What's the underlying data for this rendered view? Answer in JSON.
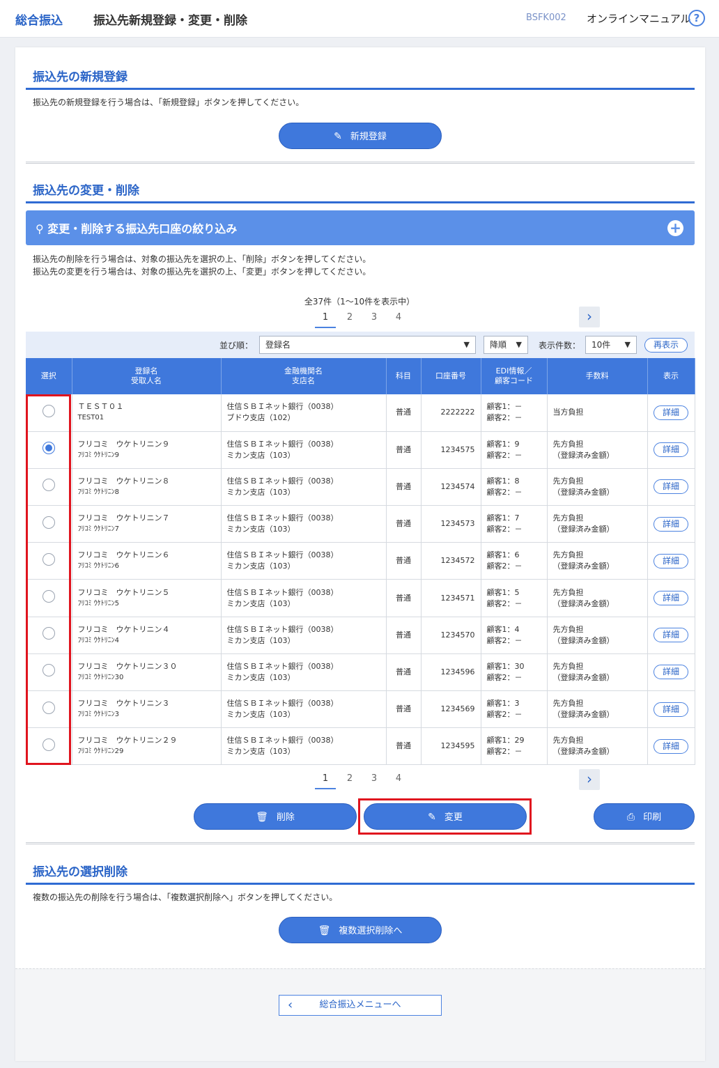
{
  "header": {
    "brand": "総合振込",
    "title": "振込先新規登録・変更・削除",
    "screen_code": "BSFK002",
    "manual_label": "オンラインマニュアル",
    "help_icon": "?"
  },
  "new_section": {
    "title": "振込先の新規登録",
    "note": "振込先の新規登録を行う場合は、「新規登録」ボタンを押してください。",
    "button_label": "新規登録"
  },
  "edit_section": {
    "title": "振込先の変更・削除",
    "filter_title": "変更・削除する振込先口座の絞り込み",
    "note_line1": "振込先の削除を行う場合は、対象の振込先を選択の上、「削除」ボタンを押してください。",
    "note_line2": "振込先の変更を行う場合は、対象の振込先を選択の上、「変更」ボタンを押してください。",
    "count_text": "全37件（1～10件を表示中）",
    "pages": [
      "1",
      "2",
      "3",
      "4"
    ],
    "next_symbol": "›",
    "sort_label": "並び順：",
    "sort_value": "登録名",
    "order_value": "降順",
    "per_page_label": "表示件数：",
    "per_page_value": "10件",
    "redisplay_label": "再表示",
    "columns": [
      "選択",
      "登録名",
      "受取人名",
      "金融機関名",
      "支店名",
      "科目",
      "口座番号",
      "EDI情報／",
      "顧客コード",
      "手数料",
      "表示"
    ],
    "rows": [
      {
        "name": "ＴＥＳＴ０１",
        "kana": "TEST01",
        "bank": "住信ＳＢＩネット銀行（0038）",
        "branch": "ブドウ支店（102）",
        "type": "普通",
        "account": "2222222",
        "edi1": "顧客1：－",
        "edi2": "顧客2：－",
        "fee1": "当方負担",
        "fee2": "",
        "detail": "詳細",
        "selected": false
      },
      {
        "name": "フリコミ　ウケトリニン９",
        "kana": "ﾌﾘｺﾐ ｳｹﾄﾘﾆﾝ9",
        "bank": "住信ＳＢＩネット銀行（0038）",
        "branch": "ミカン支店（103）",
        "type": "普通",
        "account": "1234575",
        "edi1": "顧客1：9",
        "edi2": "顧客2：－",
        "fee1": "先方負担",
        "fee2": "（登録済み金額）",
        "detail": "詳細",
        "selected": true
      },
      {
        "name": "フリコミ　ウケトリニン８",
        "kana": "ﾌﾘｺﾐ ｳｹﾄﾘﾆﾝ8",
        "bank": "住信ＳＢＩネット銀行（0038）",
        "branch": "ミカン支店（103）",
        "type": "普通",
        "account": "1234574",
        "edi1": "顧客1：8",
        "edi2": "顧客2：－",
        "fee1": "先方負担",
        "fee2": "（登録済み金額）",
        "detail": "詳細",
        "selected": false
      },
      {
        "name": "フリコミ　ウケトリニン７",
        "kana": "ﾌﾘｺﾐ ｳｹﾄﾘﾆﾝ7",
        "bank": "住信ＳＢＩネット銀行（0038）",
        "branch": "ミカン支店（103）",
        "type": "普通",
        "account": "1234573",
        "edi1": "顧客1：7",
        "edi2": "顧客2：－",
        "fee1": "先方負担",
        "fee2": "（登録済み金額）",
        "detail": "詳細",
        "selected": false
      },
      {
        "name": "フリコミ　ウケトリニン６",
        "kana": "ﾌﾘｺﾐ ｳｹﾄﾘﾆﾝ6",
        "bank": "住信ＳＢＩネット銀行（0038）",
        "branch": "ミカン支店（103）",
        "type": "普通",
        "account": "1234572",
        "edi1": "顧客1：6",
        "edi2": "顧客2：－",
        "fee1": "先方負担",
        "fee2": "（登録済み金額）",
        "detail": "詳細",
        "selected": false
      },
      {
        "name": "フリコミ　ウケトリニン５",
        "kana": "ﾌﾘｺﾐ ｳｹﾄﾘﾆﾝ5",
        "bank": "住信ＳＢＩネット銀行（0038）",
        "branch": "ミカン支店（103）",
        "type": "普通",
        "account": "1234571",
        "edi1": "顧客1：5",
        "edi2": "顧客2：－",
        "fee1": "先方負担",
        "fee2": "（登録済み金額）",
        "detail": "詳細",
        "selected": false
      },
      {
        "name": "フリコミ　ウケトリニン４",
        "kana": "ﾌﾘｺﾐ ｳｹﾄﾘﾆﾝ4",
        "bank": "住信ＳＢＩネット銀行（0038）",
        "branch": "ミカン支店（103）",
        "type": "普通",
        "account": "1234570",
        "edi1": "顧客1：4",
        "edi2": "顧客2：－",
        "fee1": "先方負担",
        "fee2": "（登録済み金額）",
        "detail": "詳細",
        "selected": false
      },
      {
        "name": "フリコミ　ウケトリニン３０",
        "kana": "ﾌﾘｺﾐ ｳｹﾄﾘﾆﾝ30",
        "bank": "住信ＳＢＩネット銀行（0038）",
        "branch": "ミカン支店（103）",
        "type": "普通",
        "account": "1234596",
        "edi1": "顧客1：30",
        "edi2": "顧客2：－",
        "fee1": "先方負担",
        "fee2": "（登録済み金額）",
        "detail": "詳細",
        "selected": false
      },
      {
        "name": "フリコミ　ウケトリニン３",
        "kana": "ﾌﾘｺﾐ ｳｹﾄﾘﾆﾝ3",
        "bank": "住信ＳＢＩネット銀行（0038）",
        "branch": "ミカン支店（103）",
        "type": "普通",
        "account": "1234569",
        "edi1": "顧客1：3",
        "edi2": "顧客2：－",
        "fee1": "先方負担",
        "fee2": "（登録済み金額）",
        "detail": "詳細",
        "selected": false
      },
      {
        "name": "フリコミ　ウケトリニン２９",
        "kana": "ﾌﾘｺﾐ ｳｹﾄﾘﾆﾝ29",
        "bank": "住信ＳＢＩネット銀行（0038）",
        "branch": "ミカン支店（103）",
        "type": "普通",
        "account": "1234595",
        "edi1": "顧客1：29",
        "edi2": "顧客2：－",
        "fee1": "先方負担",
        "fee2": "（登録済み金額）",
        "detail": "詳細",
        "selected": false
      }
    ],
    "delete_label": "削除",
    "change_label": "変更",
    "print_label": "印刷"
  },
  "multi_section": {
    "title": "振込先の選択削除",
    "note": "複数の振込先の削除を行う場合は、「複数選択削除へ」ボタンを押してください。",
    "button_label": "複数選択削除へ"
  },
  "footer": {
    "back_label": "総合振込メニューへ",
    "back_icon": "‹"
  },
  "colors": {
    "accent": "#3f78dc",
    "heading": "#2a64c7",
    "highlight": "#e0141e"
  },
  "icons": [
    "help-icon",
    "pencil-icon",
    "search-icon",
    "plus-icon",
    "chevron-right-icon",
    "dropdown-arrow-icon",
    "trash-icon",
    "printer-icon",
    "chevron-left-icon"
  ]
}
